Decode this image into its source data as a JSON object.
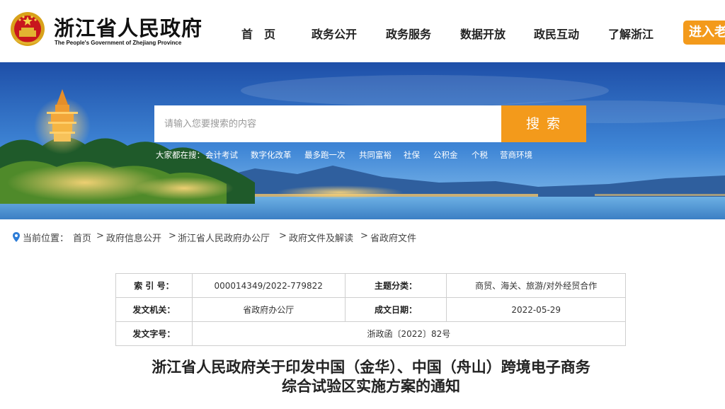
{
  "header": {
    "site_title": "浙江省人民政府",
    "site_subtitle": "The People's Government of Zhejiang Province",
    "nav": [
      "首　页",
      "政务公开",
      "政务服务",
      "数据开放",
      "政民互动",
      "了解浙江"
    ],
    "cta_label": "进入老",
    "accent": "#f39a1b"
  },
  "search": {
    "placeholder": "请输入您要搜索的内容",
    "button_label": "搜索",
    "hot_prefix": "大家都在搜：",
    "hot_terms": [
      "会计考试",
      "数字化改革",
      "最多跑一次",
      "共同富裕",
      "社保",
      "公积金",
      "个税",
      "营商环境"
    ]
  },
  "breadcrumb": {
    "prefix": "当前位置：",
    "items": [
      "首页",
      "政府信息公开",
      "浙江省人民政府办公厅",
      "政府文件及解读",
      "省政府文件"
    ],
    "separator": ">"
  },
  "meta": {
    "index_label": "索 引 号：",
    "index_value": "000014349/2022-779822",
    "topic_label": "主题分类：",
    "topic_value": "商贸、海关、旅游/对外经贸合作",
    "issuer_label": "发文机关：",
    "issuer_value": "省政府办公厅",
    "date_label": "成文日期：",
    "date_value": "2022-05-29",
    "docno_label": "发文字号：",
    "docno_value": "浙政函〔2022〕82号"
  },
  "document": {
    "title_line1": "浙江省人民政府关于印发中国（金华）、中国（舟山）跨境电子商务",
    "title_line2": "综合试验区实施方案的通知"
  }
}
